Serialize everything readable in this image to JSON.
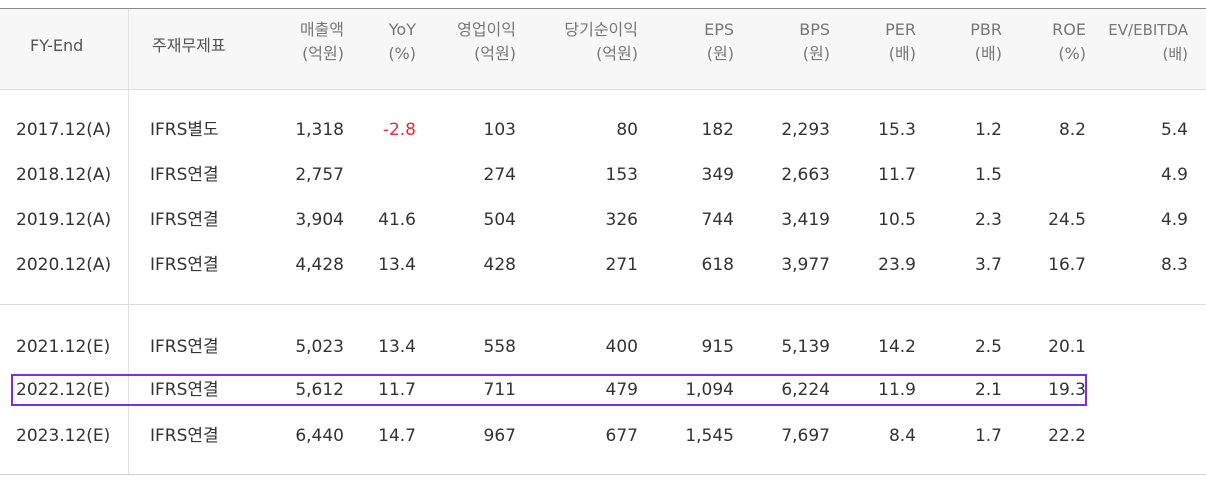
{
  "headers": {
    "fy": "FY-End",
    "basis": "주재무제표",
    "sales": {
      "label": "매출액",
      "unit": "(억원)"
    },
    "yoy": {
      "label": "YoY",
      "unit": "(%)"
    },
    "op": {
      "label": "영업이익",
      "unit": "(억원)"
    },
    "net": {
      "label": "당기순이익",
      "unit": "(억원)"
    },
    "eps": {
      "label": "EPS",
      "unit": "(원)"
    },
    "bps": {
      "label": "BPS",
      "unit": "(원)"
    },
    "per": {
      "label": "PER",
      "unit": "(배)"
    },
    "pbr": {
      "label": "PBR",
      "unit": "(배)"
    },
    "roe": {
      "label": "ROE",
      "unit": "(%)"
    },
    "ev": {
      "label": "EV/EBITDA",
      "unit": "(배)"
    }
  },
  "rows": [
    {
      "fy": "2017.12(A)",
      "basis": "IFRS별도",
      "sales": "1,318",
      "yoy": "-2.8",
      "op": "103",
      "net": "80",
      "eps": "182",
      "bps": "2,293",
      "per": "15.3",
      "pbr": "1.2",
      "roe": "8.2",
      "ev": "5.4"
    },
    {
      "fy": "2018.12(A)",
      "basis": "IFRS연결",
      "sales": "2,757",
      "yoy": "",
      "op": "274",
      "net": "153",
      "eps": "349",
      "bps": "2,663",
      "per": "11.7",
      "pbr": "1.5",
      "roe": "",
      "ev": "4.9"
    },
    {
      "fy": "2019.12(A)",
      "basis": "IFRS연결",
      "sales": "3,904",
      "yoy": "41.6",
      "op": "504",
      "net": "326",
      "eps": "744",
      "bps": "3,419",
      "per": "10.5",
      "pbr": "2.3",
      "roe": "24.5",
      "ev": "4.9"
    },
    {
      "fy": "2020.12(A)",
      "basis": "IFRS연결",
      "sales": "4,428",
      "yoy": "13.4",
      "op": "428",
      "net": "271",
      "eps": "618",
      "bps": "3,977",
      "per": "23.9",
      "pbr": "3.7",
      "roe": "16.7",
      "ev": "8.3"
    },
    {
      "fy": "2021.12(E)",
      "basis": "IFRS연결",
      "sales": "5,023",
      "yoy": "13.4",
      "op": "558",
      "net": "400",
      "eps": "915",
      "bps": "5,139",
      "per": "14.2",
      "pbr": "2.5",
      "roe": "20.1",
      "ev": ""
    },
    {
      "fy": "2022.12(E)",
      "basis": "IFRS연결",
      "sales": "5,612",
      "yoy": "11.7",
      "op": "711",
      "net": "479",
      "eps": "1,094",
      "bps": "6,224",
      "per": "11.9",
      "pbr": "2.1",
      "roe": "19.3",
      "ev": ""
    },
    {
      "fy": "2023.12(E)",
      "basis": "IFRS연결",
      "sales": "6,440",
      "yoy": "14.7",
      "op": "967",
      "net": "677",
      "eps": "1,545",
      "bps": "7,697",
      "per": "8.4",
      "pbr": "1.7",
      "roe": "22.2",
      "ev": ""
    }
  ],
  "highlight_color": "#7a2fe0",
  "negative_color": "#e03030"
}
